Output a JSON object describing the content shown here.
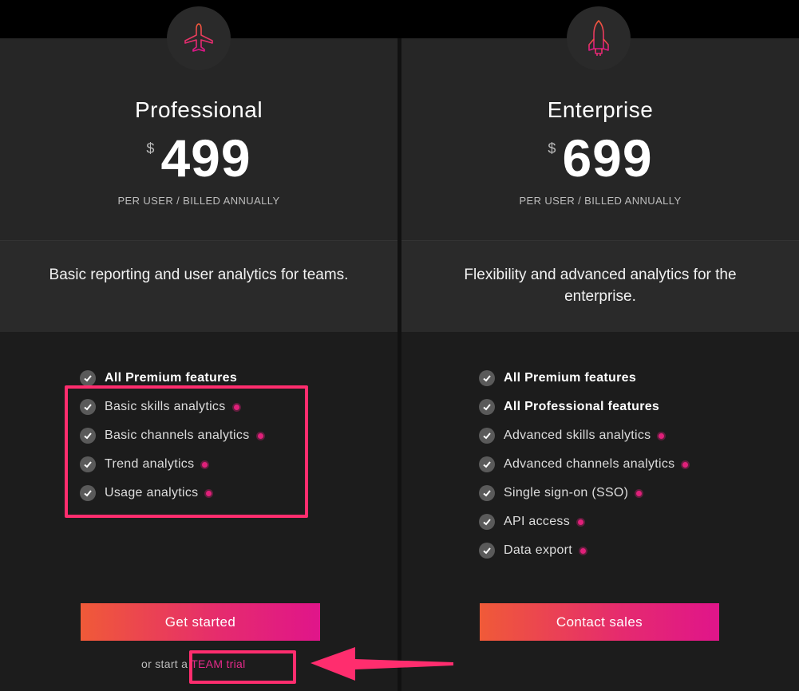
{
  "colors": {
    "accent": "#e52a8a",
    "highlight": "#ff2d6e",
    "gradient_start": "#f05a38",
    "gradient_end": "#e0158a"
  },
  "plans": [
    {
      "icon": "airplane-icon",
      "name": "Professional",
      "currency": "$",
      "price": "499",
      "billing": "PER USER / BILLED ANNUALLY",
      "description": "Basic reporting and user analytics for teams.",
      "features": [
        {
          "label": "All Premium features",
          "bold": true,
          "new": false
        },
        {
          "label": "Basic skills analytics",
          "bold": false,
          "new": true
        },
        {
          "label": "Basic channels analytics",
          "bold": false,
          "new": true
        },
        {
          "label": "Trend analytics",
          "bold": false,
          "new": true
        },
        {
          "label": "Usage analytics",
          "bold": false,
          "new": true
        }
      ],
      "cta": "Get started",
      "trial_prefix": "or start a",
      "trial_link": "TEAM trial"
    },
    {
      "icon": "rocket-icon",
      "name": "Enterprise",
      "currency": "$",
      "price": "699",
      "billing": "PER USER / BILLED ANNUALLY",
      "description": "Flexibility and advanced analytics for the enterprise.",
      "features": [
        {
          "label": "All Premium features",
          "bold": true,
          "new": false
        },
        {
          "label": "All Professional features",
          "bold": true,
          "new": false
        },
        {
          "label": "Advanced skills analytics",
          "bold": false,
          "new": true
        },
        {
          "label": "Advanced channels analytics",
          "bold": false,
          "new": true
        },
        {
          "label": "Single sign-on (SSO)",
          "bold": false,
          "new": true
        },
        {
          "label": "API access",
          "bold": false,
          "new": true
        },
        {
          "label": "Data export",
          "bold": false,
          "new": true
        }
      ],
      "cta": "Contact sales"
    }
  ]
}
